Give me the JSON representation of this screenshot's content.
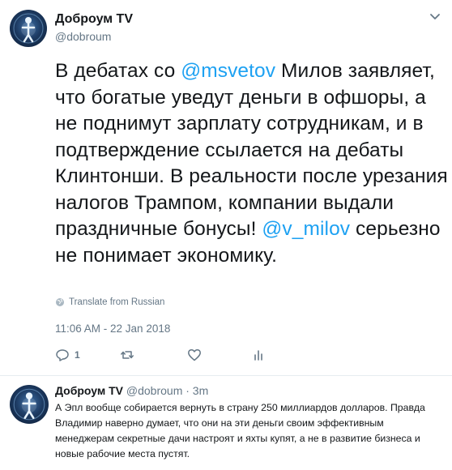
{
  "tweet": {
    "display_name": "Доброум TV",
    "handle": "@dobroum",
    "text_1": "В дебатах со ",
    "mention_1": "@msvetov",
    "text_2": " Милов заявляет, что богатые уведут деньги в офшоры, а не поднимут зарплату сотрудникам, и в подтверждение ссылается на дебаты Клинтонши. В реальности после урезания налогов Трампом, компании выдали праздничные бонусы! ",
    "mention_2": "@v_milov",
    "text_3": " серьезно не понимает экономику.",
    "translate_label": "Translate from Russian",
    "timestamp": "11:06 AM - 22 Jan 2018",
    "actions": {
      "reply_count": "1",
      "retweet_count": "",
      "like_count": ""
    }
  },
  "reply": {
    "display_name": "Доброум TV",
    "meta": "@dobroum · 3m",
    "text": "А Эпл вообще собирается вернуть в страну 250 миллиардов долларов. Правда Владимир наверно думает, что они на эти деньги своим эффективным менеджерам секретные дачи настроят и яхты купят, а не в развитие бизнеса и новые рабочие места пустят."
  },
  "colors": {
    "accent": "#1da1f2",
    "secondary_text": "#657786",
    "primary_text": "#14171a",
    "divider": "#e6ecf0"
  },
  "icons": {
    "avatar": "glowing-figure-avatar",
    "menu": "chevron-down-icon",
    "translate": "globe-icon",
    "reply": "reply-icon",
    "retweet": "retweet-icon",
    "like": "heart-icon",
    "analytics": "analytics-icon"
  }
}
